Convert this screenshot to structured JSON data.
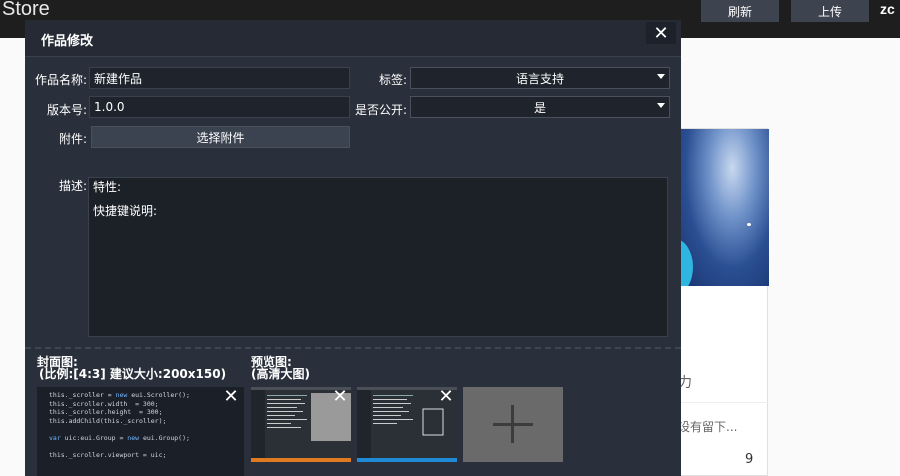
{
  "header": {
    "store_title": "Store",
    "refresh_label": "刷新",
    "upload_label": "上传",
    "user": "zc"
  },
  "background": {
    "text_fragment_1": "力",
    "text_fragment_2": "设有留下...",
    "count": "9"
  },
  "dialog": {
    "title": "作品修改",
    "close_icon": "close-icon",
    "fields": {
      "name_label": "作品名称:",
      "name_value": "新建作品",
      "version_label": "版本号:",
      "version_value": "1.0.0",
      "tag_label": "标签:",
      "tag_value": "语言支持",
      "public_label": "是否公开:",
      "public_value": "是",
      "attachment_label": "附件:",
      "attachment_button": "选择附件",
      "description_label": "描述:",
      "description_line1": "特性:",
      "description_line2": "快捷键说明:"
    },
    "cover": {
      "label_line1": "封面图:",
      "label_line2": "(比例:[4:3] 建议大小:200x150)"
    },
    "preview": {
      "label_line1": "预览图:",
      "label_line2": "(高清大图)"
    },
    "add_icon": "plus-icon"
  },
  "colors": {
    "dialog_bg": "#2a303b",
    "field_bg": "#1e232c",
    "topbar_bg": "#1e1e1e"
  }
}
